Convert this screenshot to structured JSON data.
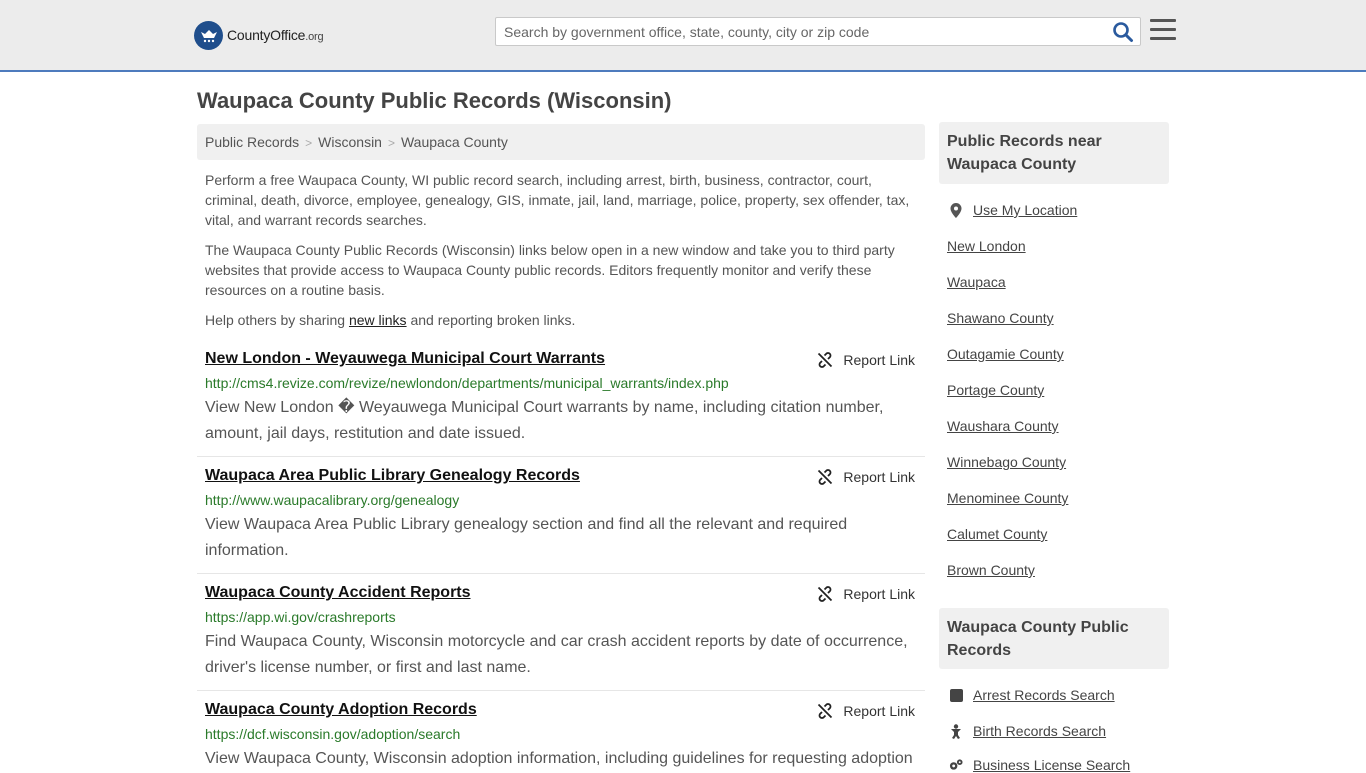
{
  "header": {
    "logo_brand": "CountyOffice",
    "logo_tld": ".org",
    "search_placeholder": "Search by government office, state, county, city or zip code"
  },
  "main": {
    "title": "Waupaca County Public Records (Wisconsin)",
    "breadcrumb": [
      "Public Records",
      "Wisconsin",
      "Waupaca County"
    ],
    "intro1": "Perform a free Waupaca County, WI public record search, including arrest, birth, business, contractor, court, criminal, death, divorce, employee, genealogy, GIS, inmate, jail, land, marriage, police, property, sex offender, tax, vital, and warrant records searches.",
    "intro2": "The Waupaca County Public Records (Wisconsin) links below open in a new window and take you to third party websites that provide access to Waupaca County public records. Editors frequently monitor and verify these resources on a routine basis.",
    "help_prefix": "Help others by sharing ",
    "help_link": "new links",
    "help_suffix": " and reporting broken links.",
    "report_label": "Report Link",
    "records": [
      {
        "title": "New London - Weyauwega Municipal Court Warrants",
        "url": "http://cms4.revize.com/revize/newlondon/departments/municipal_warrants/index.php",
        "desc": "View New London � Weyauwega Municipal Court warrants by name, including citation number, amount, jail days, restitution and date issued."
      },
      {
        "title": "Waupaca Area Public Library Genealogy Records",
        "url": "http://www.waupacalibrary.org/genealogy",
        "desc": "View Waupaca Area Public Library genealogy section and find all the relevant and required information."
      },
      {
        "title": "Waupaca County Accident Reports",
        "url": "https://app.wi.gov/crashreports",
        "desc": "Find Waupaca County, Wisconsin motorcycle and car crash accident reports by date of occurrence, driver's license number, or first and last name."
      },
      {
        "title": "Waupaca County Adoption Records",
        "url": "https://dcf.wisconsin.gov/adoption/search",
        "desc": "View Waupaca County, Wisconsin adoption information, including guidelines for requesting adoption"
      }
    ]
  },
  "sidebar": {
    "near_title": "Public Records near Waupaca County",
    "use_location": "Use My Location",
    "near_links": [
      "New London",
      "Waupaca",
      "Shawano County",
      "Outagamie County",
      "Portage County",
      "Waushara County",
      "Winnebago County",
      "Menominee County",
      "Calumet County",
      "Brown County"
    ],
    "records_title": "Waupaca County Public Records",
    "record_links": [
      "Arrest Records Search",
      "Birth Records Search",
      "Business License Search"
    ]
  }
}
